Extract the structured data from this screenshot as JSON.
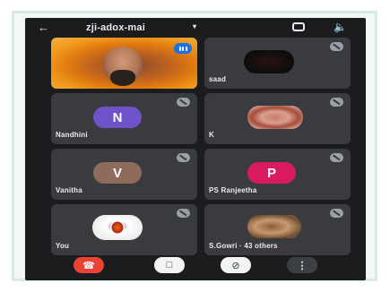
{
  "header": {
    "back_icon": "arrow-left-icon",
    "title": "zji-adox-mai",
    "caret": "▾",
    "camera_icon": "switch-camera-icon",
    "speaker_icon": "speaker-icon"
  },
  "participants": [
    {
      "name": "",
      "type": "video",
      "speaking": true
    },
    {
      "name": "saad",
      "type": "photo"
    },
    {
      "name": "Nandhini",
      "type": "initial",
      "initial": "N",
      "color": "#6d52c8"
    },
    {
      "name": "K",
      "type": "photo"
    },
    {
      "name": "Vanitha",
      "type": "initial",
      "initial": "V",
      "color": "#8e6b5b"
    },
    {
      "name": "PS Ranjeetha",
      "type": "initial",
      "initial": "P",
      "color": "#d81b60"
    },
    {
      "name": "You",
      "type": "photo"
    },
    {
      "name": "S.Gowri · 43 others",
      "type": "photo"
    }
  ],
  "controls": {
    "end_call_icon": "phone-hangup-icon",
    "camera_off_icon": "camera-off-icon",
    "mic_off_icon": "mic-off-icon",
    "more_label": "⋮"
  }
}
